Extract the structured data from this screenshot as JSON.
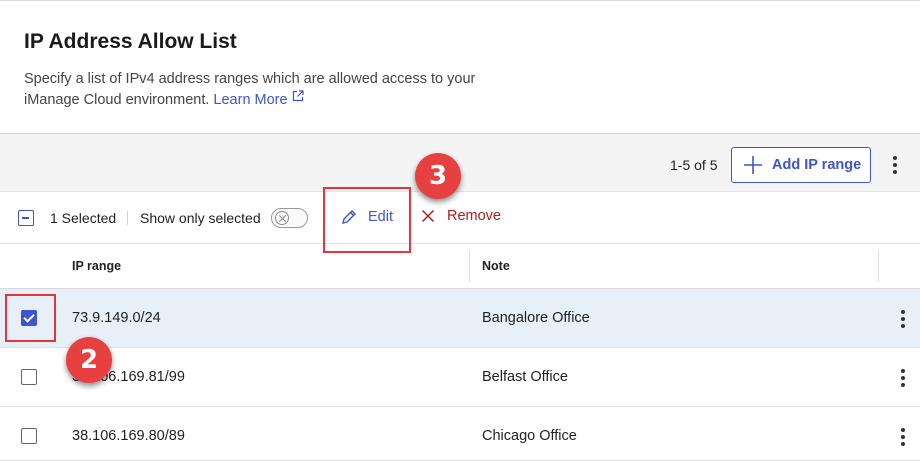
{
  "header": {
    "title": "IP Address Allow List",
    "description_line1": "Specify a list of IPv4 address ranges which are allowed access to your",
    "description_line2": "iManage Cloud environment.",
    "learn_more": "Learn More"
  },
  "toolbar": {
    "count": "1-5 of 5",
    "add_label": "Add IP range",
    "more_icon": "kebab-vertical-icon"
  },
  "selection_bar": {
    "selected_count": "1 Selected",
    "show_only_selected": "Show only selected",
    "show_only_selected_on": false,
    "edit_label": "Edit",
    "remove_label": "Remove"
  },
  "table": {
    "columns": [
      "IP range",
      "Note"
    ],
    "rows": [
      {
        "ip": "73.9.149.0/24",
        "note": "Bangalore Office",
        "selected": true
      },
      {
        "ip": "38.106.169.81/99",
        "note": "Belfast Office",
        "selected": false
      },
      {
        "ip": "38.106.169.80/89",
        "note": "Chicago Office",
        "selected": false
      }
    ]
  },
  "annotations": {
    "step_checkbox": "2",
    "step_edit": "3"
  },
  "colors": {
    "accent": "#3f55c8",
    "danger": "#a82020",
    "selected_row": "#e7eff8",
    "annotation_red": "#e84040"
  }
}
